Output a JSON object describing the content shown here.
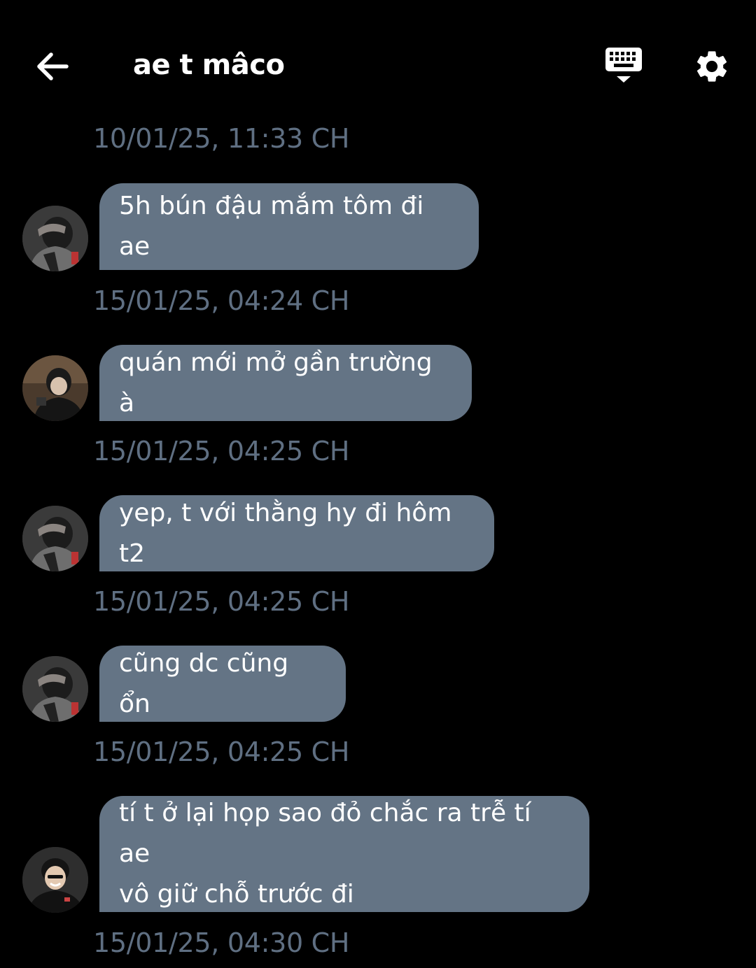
{
  "header": {
    "title": "ae t mâco",
    "back_icon": "arrow-left-icon",
    "keyboard_icon": "keyboard-icon",
    "settings_icon": "gear-icon"
  },
  "colors": {
    "background": "#000000",
    "bubble": "#647485",
    "timestamp": "#5f6f82",
    "text": "#ffffff"
  },
  "messages": [
    {
      "timestamp": "10/01/25, 11:33 CH",
      "text": "5h bún đậu mắm tôm đi ae"
    },
    {
      "timestamp": "15/01/25, 04:24 CH",
      "text": "quán mới mở gần trường à"
    },
    {
      "timestamp": "15/01/25, 04:25 CH",
      "text": "yep, t với thằng hy đi hôm t2"
    },
    {
      "timestamp": "15/01/25, 04:25 CH",
      "text": "cũng dc cũng ổn"
    },
    {
      "timestamp": "15/01/25, 04:25 CH",
      "text": "tí t ở lại họp sao đỏ chắc ra trễ tí ae\nvô giữ chỗ trước đi"
    },
    {
      "timestamp": "15/01/25, 04:30 CH"
    }
  ]
}
